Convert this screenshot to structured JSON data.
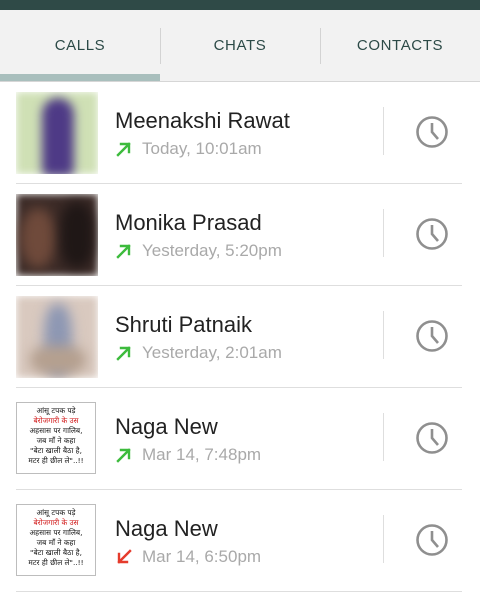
{
  "tabs": [
    {
      "label": "CALLS",
      "active": true
    },
    {
      "label": "CHATS",
      "active": false
    },
    {
      "label": "CONTACTS",
      "active": false
    }
  ],
  "colors": {
    "accent": "#2c4a47",
    "outgoing_arrow": "#3dbb3d",
    "missed_arrow": "#e53b2c"
  },
  "calls": [
    {
      "name": "Meenakshi Rawat",
      "time": "Today, 10:01am",
      "direction": "outgoing",
      "avatar": "photo"
    },
    {
      "name": "Monika Prasad",
      "time": "Yesterday, 5:20pm",
      "direction": "outgoing",
      "avatar": "photo"
    },
    {
      "name": "Shruti Patnaik",
      "time": "Yesterday, 2:01am",
      "direction": "outgoing",
      "avatar": "photo"
    },
    {
      "name": "Naga New",
      "time": "Mar 14, 7:48pm",
      "direction": "outgoing",
      "avatar": "quote-image"
    },
    {
      "name": "Naga New",
      "time": "Mar 14, 6:50pm",
      "direction": "incoming-missed",
      "avatar": "quote-image"
    }
  ],
  "avatar_quote_lines": [
    "आंसू टपक पड़े",
    "बेरोजगारी के उस",
    "अहसास पर गालिब,",
    "जब माँ ने कहा",
    "\"बेटा खाली बैठा है,",
    "मटर ही छील ले\"..!!"
  ],
  "icons": {
    "history": "clock-icon",
    "outgoing": "outgoing-arrow-icon",
    "missed": "missed-call-arrow-icon"
  }
}
